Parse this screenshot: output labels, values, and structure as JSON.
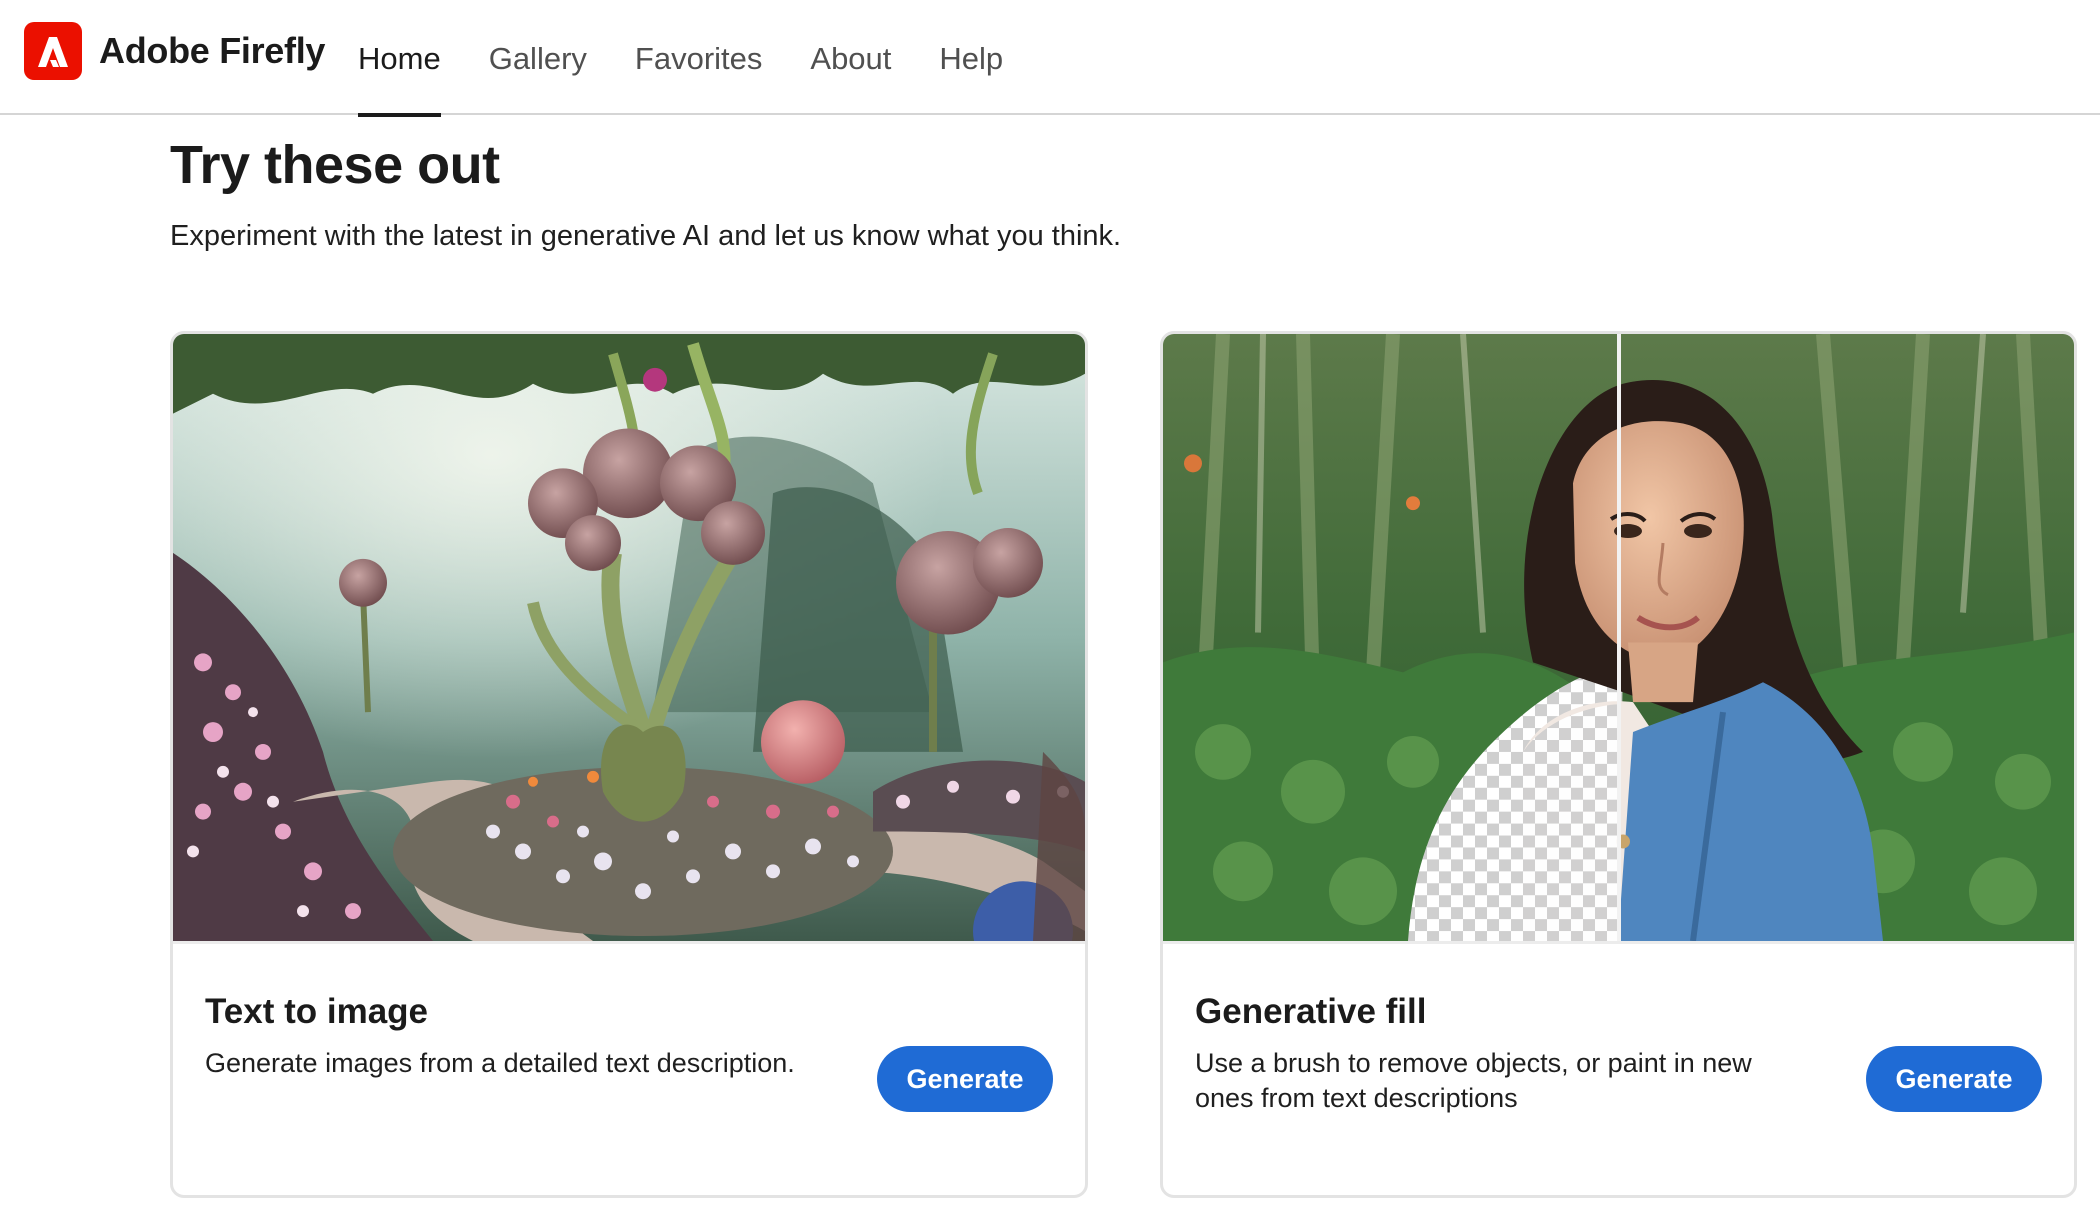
{
  "app": {
    "brand_name": "Adobe Firefly",
    "brand_icon": "adobe-firefly-logo",
    "brand_color": "#eb1000"
  },
  "nav": {
    "items": [
      {
        "label": "Home",
        "active": true
      },
      {
        "label": "Gallery",
        "active": false
      },
      {
        "label": "Favorites",
        "active": false
      },
      {
        "label": "About",
        "active": false
      },
      {
        "label": "Help",
        "active": false
      }
    ]
  },
  "main": {
    "title": "Try these out",
    "subtitle": "Experiment with the latest in generative AI and let us know what you think."
  },
  "cards": [
    {
      "image": "fantasy-garden-illustration",
      "title": "Text to image",
      "description": "Generate images from a detailed text description.",
      "button_label": "Generate"
    },
    {
      "image": "woman-portrait-generative-fill-split",
      "title": "Generative fill",
      "description": "Use a brush to remove objects, or paint in new ones from text descriptions",
      "button_label": "Generate"
    }
  ],
  "colors": {
    "accent_button": "#1f6bd5",
    "text_primary": "#1b1b1b"
  }
}
